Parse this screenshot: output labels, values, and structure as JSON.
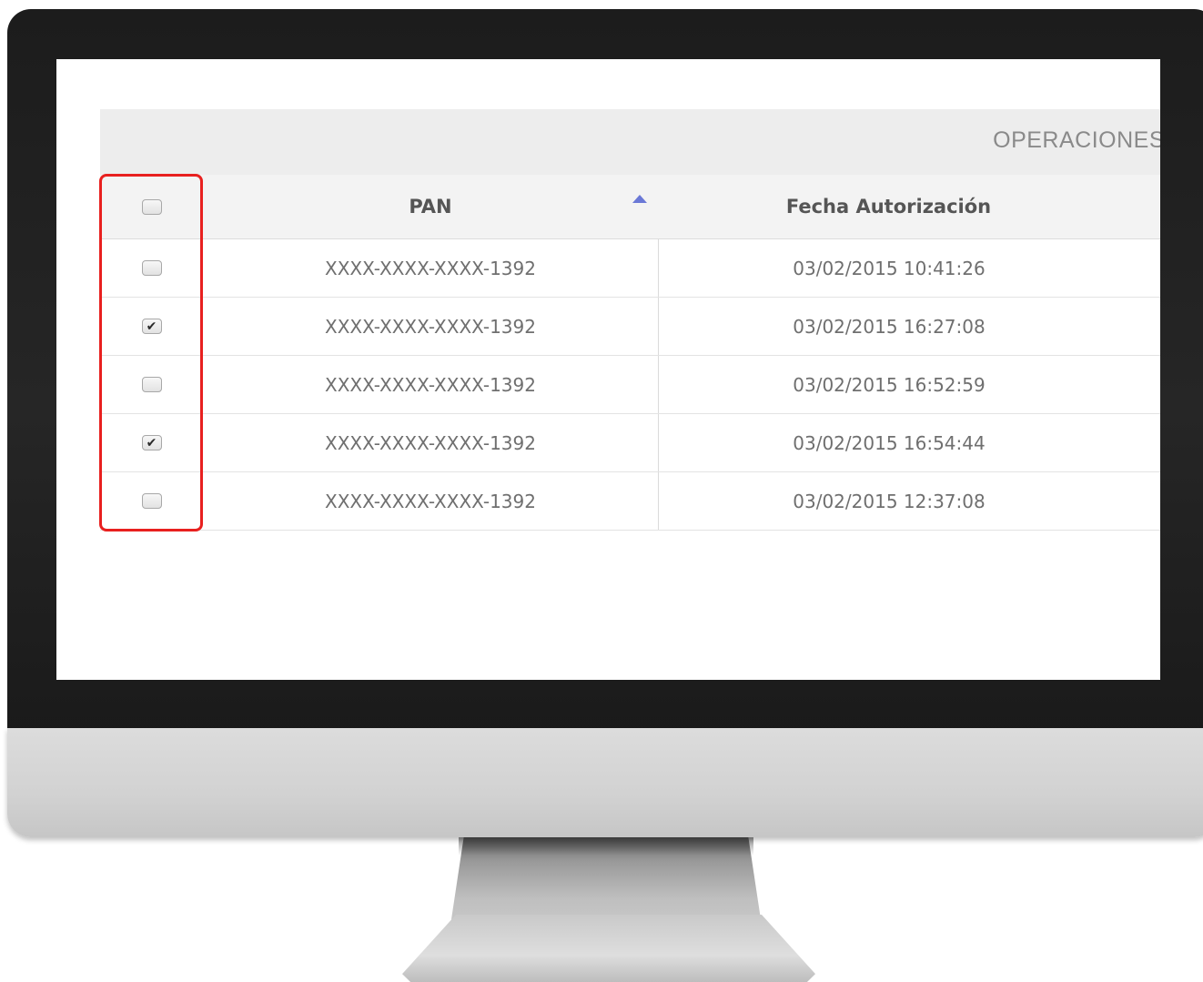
{
  "screen": {
    "title": "OPERACIONES",
    "columns": {
      "select_all_checked": false,
      "pan_label": "PAN",
      "date_label": "Fecha Autorización"
    },
    "sort_icon": "sort-ascending-icon",
    "rows": [
      {
        "checked": false,
        "pan": "XXXX-XXXX-XXXX-1392",
        "date": "03/02/2015 10:41:26"
      },
      {
        "checked": true,
        "pan": "XXXX-XXXX-XXXX-1392",
        "date": "03/02/2015 16:27:08"
      },
      {
        "checked": false,
        "pan": "XXXX-XXXX-XXXX-1392",
        "date": "03/02/2015 16:52:59"
      },
      {
        "checked": true,
        "pan": "XXXX-XXXX-XXXX-1392",
        "date": "03/02/2015 16:54:44"
      },
      {
        "checked": false,
        "pan": "XXXX-XXXX-XXXX-1392",
        "date": "03/02/2015 12:37:08"
      }
    ]
  },
  "colors": {
    "highlight": "#e8201f",
    "sort_arrow": "#6a78d6",
    "bezel": "#1c1c1c",
    "chin": "#d2d2d2"
  }
}
